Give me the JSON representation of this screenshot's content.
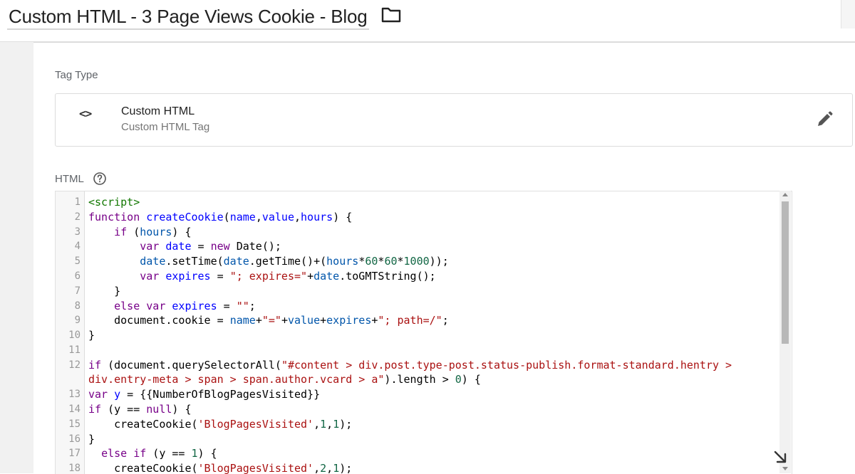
{
  "header": {
    "title": "Custom HTML - 3 Page Views Cookie - Blog",
    "folder_icon": "folder-icon"
  },
  "tag_type": {
    "label": "Tag Type",
    "card": {
      "icon": "code-brackets-icon",
      "icon_text": "<>",
      "name": "Custom HTML",
      "subtitle": "Custom HTML Tag",
      "edit_icon": "pencil-icon"
    }
  },
  "html": {
    "label": "HTML",
    "help_icon": "help-circle-icon",
    "line_numbers": [
      "1",
      "2",
      "3",
      "4",
      "5",
      "6",
      "7",
      "8",
      "9",
      "10",
      "11",
      "12",
      "",
      "13",
      "14",
      "15",
      "16",
      "17",
      "18"
    ]
  }
}
